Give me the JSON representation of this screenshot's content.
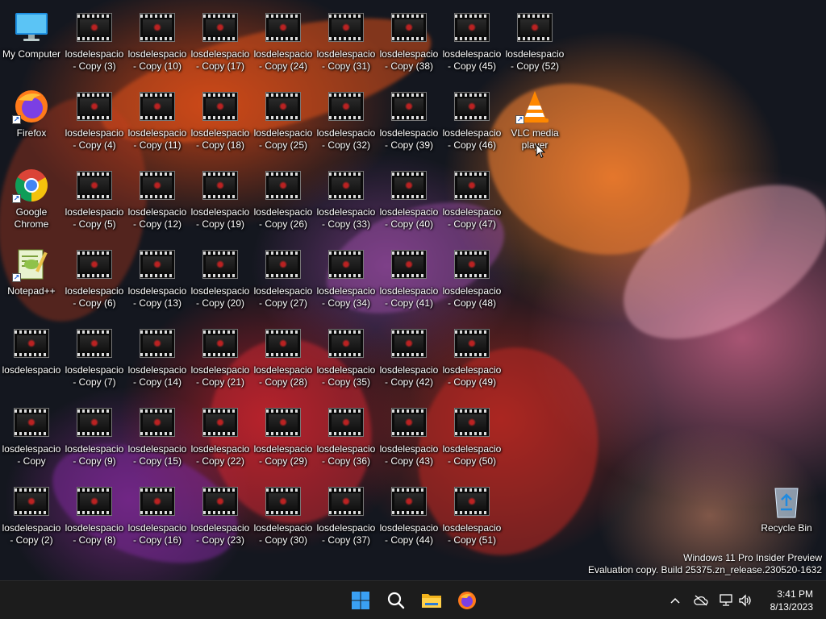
{
  "desktop": {
    "icons": [
      {
        "label": "My Computer",
        "type": "computer-icon"
      },
      {
        "label": "Firefox",
        "type": "firefox-icon",
        "shortcut": true
      },
      {
        "label": "Google Chrome",
        "type": "chrome-icon",
        "shortcut": true
      },
      {
        "label": "Notepad++",
        "type": "notepadpp-icon",
        "shortcut": true
      },
      {
        "label": "losdelespacio",
        "type": "video-file-icon"
      },
      {
        "label": "losdelespacio - Copy",
        "type": "video-file-icon"
      },
      {
        "label": "losdelespacio - Copy (2)",
        "type": "video-file-icon"
      },
      {
        "label": "losdelespacio - Copy (3)",
        "type": "video-file-icon"
      },
      {
        "label": "losdelespacio - Copy (4)",
        "type": "video-file-icon"
      },
      {
        "label": "losdelespacio - Copy (5)",
        "type": "video-file-icon"
      },
      {
        "label": "losdelespacio - Copy (6)",
        "type": "video-file-icon"
      },
      {
        "label": "losdelespacio - Copy (7)",
        "type": "video-file-icon"
      },
      {
        "label": "losdelespacio - Copy (9)",
        "type": "video-file-icon"
      },
      {
        "label": "losdelespacio - Copy (8)",
        "type": "video-file-icon"
      },
      {
        "label": "losdelespacio - Copy (10)",
        "type": "video-file-icon"
      },
      {
        "label": "losdelespacio - Copy (11)",
        "type": "video-file-icon"
      },
      {
        "label": "losdelespacio - Copy (12)",
        "type": "video-file-icon"
      },
      {
        "label": "losdelespacio - Copy (13)",
        "type": "video-file-icon"
      },
      {
        "label": "losdelespacio - Copy (14)",
        "type": "video-file-icon"
      },
      {
        "label": "losdelespacio - Copy (15)",
        "type": "video-file-icon"
      },
      {
        "label": "losdelespacio - Copy (16)",
        "type": "video-file-icon"
      },
      {
        "label": "losdelespacio - Copy (17)",
        "type": "video-file-icon"
      },
      {
        "label": "losdelespacio - Copy (18)",
        "type": "video-file-icon"
      },
      {
        "label": "losdelespacio - Copy (19)",
        "type": "video-file-icon"
      },
      {
        "label": "losdelespacio - Copy (20)",
        "type": "video-file-icon"
      },
      {
        "label": "losdelespacio - Copy (21)",
        "type": "video-file-icon"
      },
      {
        "label": "losdelespacio - Copy (22)",
        "type": "video-file-icon"
      },
      {
        "label": "losdelespacio - Copy (23)",
        "type": "video-file-icon"
      },
      {
        "label": "losdelespacio - Copy (24)",
        "type": "video-file-icon"
      },
      {
        "label": "losdelespacio - Copy (25)",
        "type": "video-file-icon"
      },
      {
        "label": "losdelespacio - Copy (26)",
        "type": "video-file-icon"
      },
      {
        "label": "losdelespacio - Copy (27)",
        "type": "video-file-icon"
      },
      {
        "label": "losdelespacio - Copy (28)",
        "type": "video-file-icon"
      },
      {
        "label": "losdelespacio - Copy (29)",
        "type": "video-file-icon"
      },
      {
        "label": "losdelespacio - Copy (30)",
        "type": "video-file-icon"
      },
      {
        "label": "losdelespacio - Copy (31)",
        "type": "video-file-icon"
      },
      {
        "label": "losdelespacio - Copy (32)",
        "type": "video-file-icon"
      },
      {
        "label": "losdelespacio - Copy (33)",
        "type": "video-file-icon"
      },
      {
        "label": "losdelespacio - Copy (34)",
        "type": "video-file-icon"
      },
      {
        "label": "losdelespacio - Copy (35)",
        "type": "video-file-icon"
      },
      {
        "label": "losdelespacio - Copy (36)",
        "type": "video-file-icon"
      },
      {
        "label": "losdelespacio - Copy (37)",
        "type": "video-file-icon"
      },
      {
        "label": "losdelespacio - Copy (38)",
        "type": "video-file-icon"
      },
      {
        "label": "losdelespacio - Copy (39)",
        "type": "video-file-icon"
      },
      {
        "label": "losdelespacio - Copy (40)",
        "type": "video-file-icon"
      },
      {
        "label": "losdelespacio - Copy (41)",
        "type": "video-file-icon"
      },
      {
        "label": "losdelespacio - Copy (42)",
        "type": "video-file-icon"
      },
      {
        "label": "losdelespacio - Copy (43)",
        "type": "video-file-icon"
      },
      {
        "label": "losdelespacio - Copy (44)",
        "type": "video-file-icon"
      },
      {
        "label": "losdelespacio - Copy (45)",
        "type": "video-file-icon"
      },
      {
        "label": "losdelespacio - Copy (46)",
        "type": "video-file-icon"
      },
      {
        "label": "losdelespacio - Copy (47)",
        "type": "video-file-icon"
      },
      {
        "label": "losdelespacio - Copy (48)",
        "type": "video-file-icon"
      },
      {
        "label": "losdelespacio - Copy (49)",
        "type": "video-file-icon"
      },
      {
        "label": "losdelespacio - Copy (50)",
        "type": "video-file-icon"
      },
      {
        "label": "losdelespacio - Copy (51)",
        "type": "video-file-icon"
      },
      {
        "label": "losdelespacio - Copy (52)",
        "type": "video-file-icon"
      },
      {
        "label": "VLC media player",
        "type": "vlc-icon",
        "shortcut": true
      },
      {
        "label": "Recycle Bin",
        "type": "recycle-bin-icon"
      }
    ],
    "watermark": {
      "line1": "Windows 11 Pro Insider Preview",
      "line2": "Evaluation copy. Build 25375.zn_release.230520-1632"
    }
  },
  "taskbar": {
    "pinned": [
      {
        "name": "start-button",
        "icon": "windows-logo-icon"
      },
      {
        "name": "search-button",
        "icon": "search-icon"
      },
      {
        "name": "file-explorer-button",
        "icon": "folder-icon"
      },
      {
        "name": "firefox-taskbar-button",
        "icon": "firefox-icon"
      }
    ],
    "tray": [
      {
        "name": "show-hidden-icons-button",
        "icon": "chevron-up-icon"
      },
      {
        "name": "onedrive-tray-icon",
        "icon": "cloud-off-icon"
      },
      {
        "name": "network-tray-icon",
        "icon": "network-icon"
      },
      {
        "name": "volume-tray-icon",
        "icon": "speaker-icon"
      }
    ],
    "clock": {
      "time": "3:41 PM",
      "date": "8/13/2023"
    }
  },
  "colors": {
    "taskbar": "#1c1c1c",
    "accent": "#0078d4",
    "wallpaper_base": "#14171f"
  }
}
